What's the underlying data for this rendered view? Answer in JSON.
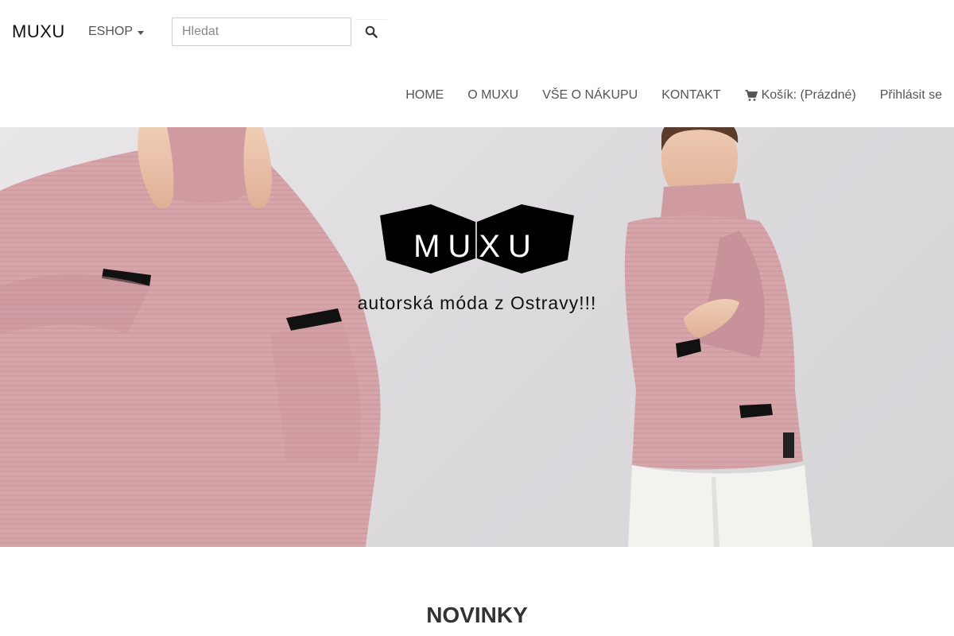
{
  "navbar": {
    "brand": "MUXU",
    "eshop_label": "ESHOP",
    "search": {
      "placeholder": "Hledat",
      "value": ""
    },
    "links": [
      {
        "label": "HOME"
      },
      {
        "label": "O MUXU"
      },
      {
        "label": "VŠE O NÁKUPU"
      },
      {
        "label": "KONTAKT"
      }
    ],
    "cart_label": "Košík: (Prázdné)",
    "login_label": "Přihlásit se"
  },
  "hero": {
    "logo_text": "MUXU",
    "tagline": "autorská móda z Ostravy!!!"
  },
  "section": {
    "title": "NOVINKY"
  },
  "icons": {
    "search": "search-icon",
    "cart": "cart-icon",
    "caret": "caret-down-icon"
  },
  "colors": {
    "sweater": "#d9a9ad",
    "hero_bg": "#e0dee1",
    "logo": "#000000"
  }
}
